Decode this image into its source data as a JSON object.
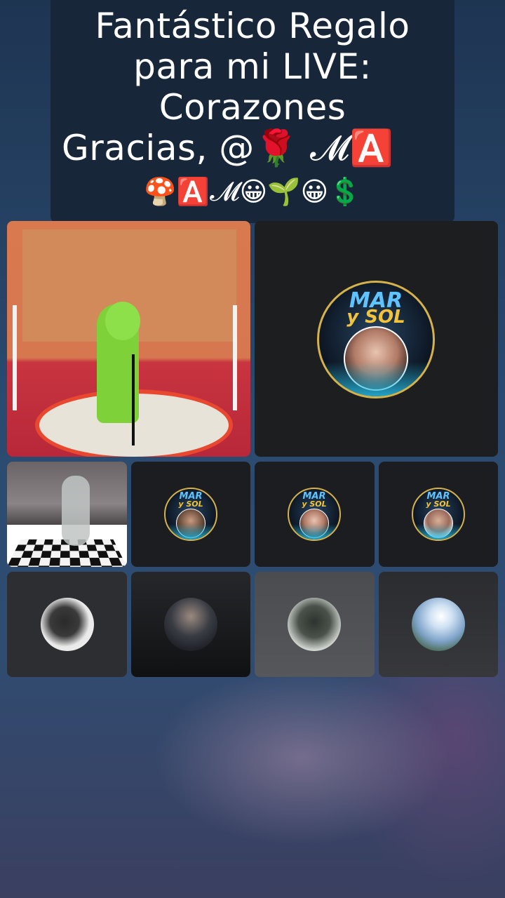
{
  "banner": {
    "line1": "Fantástico Regalo",
    "line2": "para mi LIVE:",
    "line3": "Corazones",
    "line4": "Gracias, @🌹          𝓜🅰️",
    "line5": "🍄🅰️𝓜😀🌱😀💲"
  },
  "tiles": [
    {
      "kind": "stage-video"
    },
    {
      "kind": "logo",
      "logo_text_1": "MAR",
      "logo_text_2": "y SOL"
    },
    {
      "kind": "dance-video"
    },
    {
      "kind": "logo",
      "logo_text_1": "MAR",
      "logo_text_2": "y SOL"
    },
    {
      "kind": "logo",
      "logo_text_1": "MAR",
      "logo_text_2": "y SOL"
    },
    {
      "kind": "logo",
      "logo_text_1": "MAR",
      "logo_text_2": "y SOL"
    },
    {
      "kind": "avatar"
    },
    {
      "kind": "avatar"
    },
    {
      "kind": "avatar"
    },
    {
      "kind": "avatar"
    }
  ]
}
